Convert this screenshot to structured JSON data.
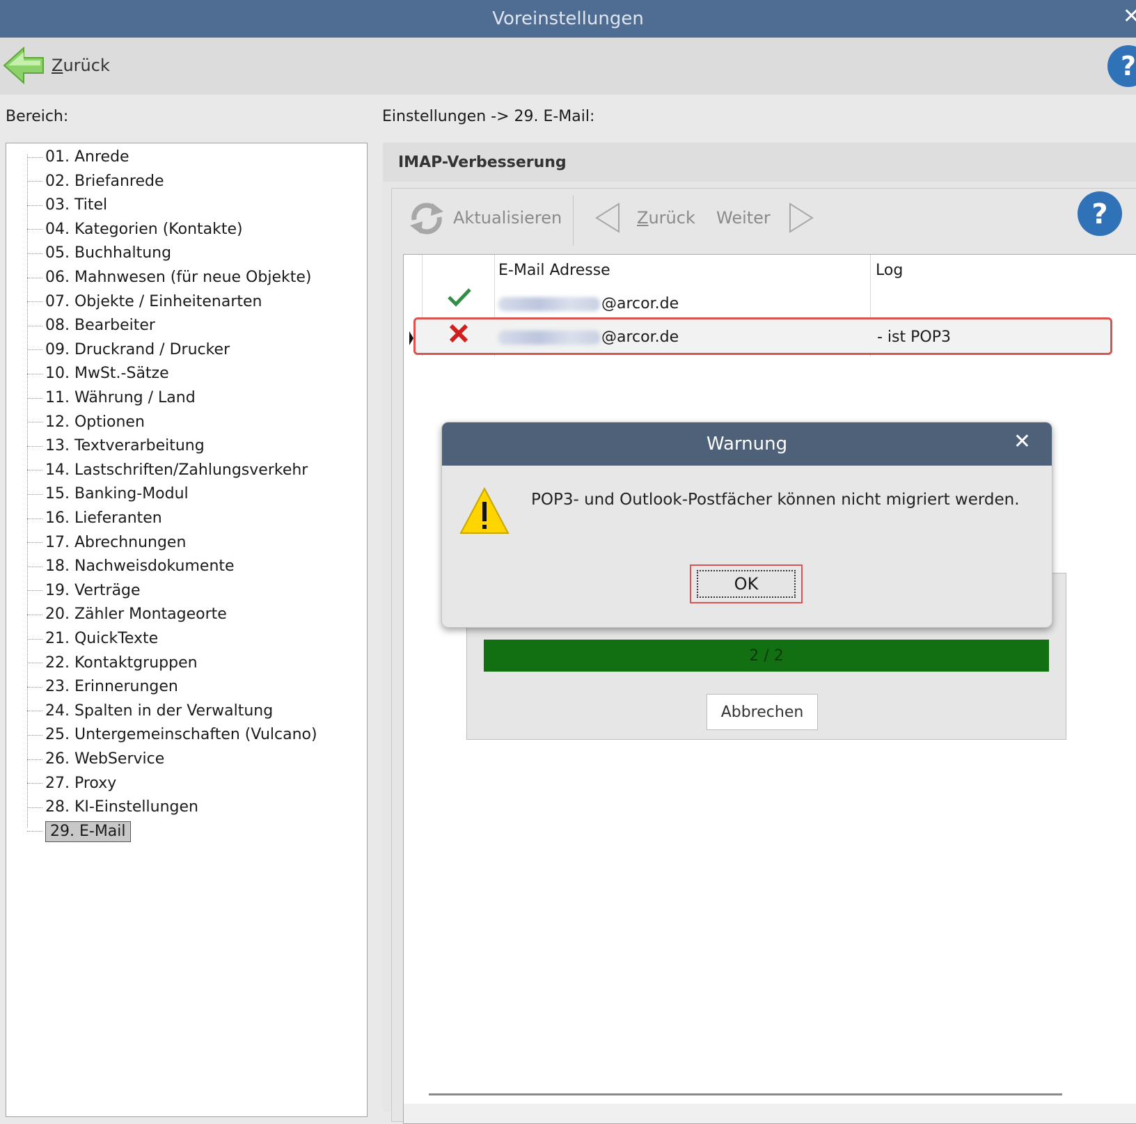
{
  "window": {
    "title": "Voreinstellungen",
    "close_glyph": "✕"
  },
  "toolbar": {
    "back_label_ul": "Z",
    "back_label_rest": "urück"
  },
  "labels": {
    "bereich": "Bereich:",
    "breadcrumb": "Einstellungen -> 29. E-Mail:"
  },
  "tree": {
    "items": [
      "01. Anrede",
      "02. Briefanrede",
      "03. Titel",
      "04. Kategorien (Kontakte)",
      "05. Buchhaltung",
      "06. Mahnwesen (für neue Objekte)",
      "07. Objekte / Einheitenarten",
      "08. Bearbeiter",
      "09. Druckrand / Drucker",
      "10. MwSt.-Sätze",
      "11. Währung / Land",
      "12. Optionen",
      "13. Textverarbeitung",
      "14. Lastschriften/Zahlungsverkehr",
      "15. Banking-Modul",
      "16. Lieferanten",
      "17. Abrechnungen",
      "18. Nachweisdokumente",
      "19. Verträge",
      "20. Zähler Montageorte",
      "21. QuickTexte",
      "22. Kontaktgruppen",
      "23. Erinnerungen",
      "24. Spalten in der Verwaltung",
      "25. Untergemeinschaften (Vulcano)",
      "26. WebService",
      "27. Proxy",
      "28. KI-Einstellungen",
      "29. E-Mail"
    ],
    "selected_index": 28
  },
  "panel": {
    "title": "IMAP-Verbesserung",
    "refresh_label": "Aktualisieren",
    "prev_label_ul": "Z",
    "prev_label_rest": "urück",
    "next_label": "Weiter"
  },
  "grid": {
    "headers": {
      "email": "E-Mail Adresse",
      "log": "Log"
    },
    "rows": [
      {
        "status": "ok",
        "email_suffix": "@arcor.de",
        "log": ""
      },
      {
        "status": "error",
        "email_suffix": "@arcor.de",
        "log": "- ist POP3"
      }
    ]
  },
  "progress": {
    "text": "2 / 2",
    "fraction": 1.0,
    "cancel_label": "Abbrechen"
  },
  "dialog": {
    "title": "Warnung",
    "close_glyph": "✕",
    "message": "POP3- und Outlook-Postfächer können nicht migriert werden.",
    "ok_label": "OK"
  },
  "colors": {
    "titlebar": "#4f6c92",
    "dialog_title": "#4f6179",
    "progress": "#127012",
    "highlight": "#d9534f"
  }
}
